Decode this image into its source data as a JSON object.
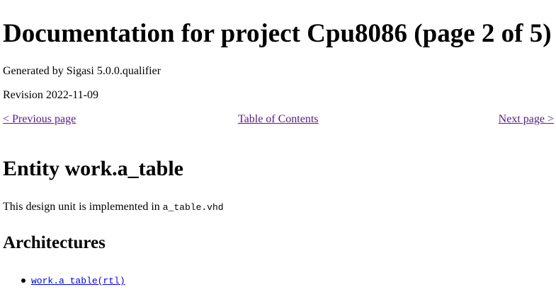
{
  "page_title": "Documentation for project Cpu8086 (page 2 of 5)",
  "generated_by": "Generated by Sigasi 5.0.0.qualifier",
  "revision": "Revision 2022-11-09",
  "nav": {
    "previous": "< Previous page",
    "toc": "Table of Contents",
    "next": "Next page >"
  },
  "entity": {
    "title": "Entity work.a_table",
    "impl_prefix": "This design unit is implemented in ",
    "impl_file": "a_table.vhd"
  },
  "architectures": {
    "title": "Architectures",
    "items": [
      {
        "label": "work.a_table(rtl)"
      }
    ]
  },
  "colors": {
    "visited_link": "#551a8b",
    "link": "#0000ee",
    "text": "#000000",
    "background": "#ffffff"
  }
}
